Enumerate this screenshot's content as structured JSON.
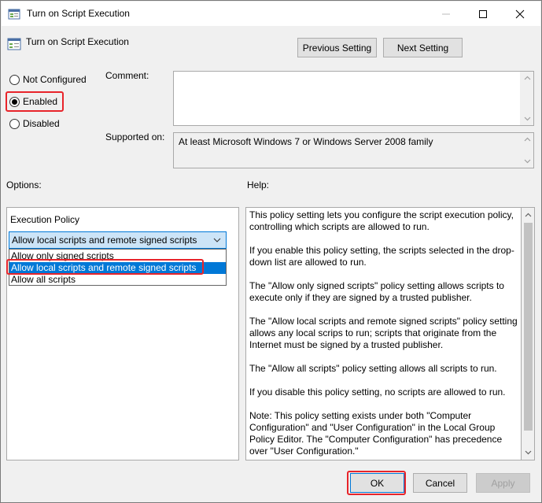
{
  "window": {
    "title": "Turn on Script Execution",
    "icons": {
      "app": "policy-icon",
      "minimize": "minimize-icon",
      "maximize": "maximize-icon",
      "close": "close-icon"
    }
  },
  "header": {
    "title": "Turn on Script Execution",
    "previous_label": "Previous Setting",
    "next_label": "Next Setting"
  },
  "state": {
    "options": [
      "Not Configured",
      "Enabled",
      "Disabled"
    ],
    "selected": "Enabled"
  },
  "comment": {
    "label": "Comment:",
    "value": ""
  },
  "supported": {
    "label": "Supported on:",
    "value": "At least Microsoft Windows 7 or Windows Server 2008 family"
  },
  "options_panel": {
    "label": "Options:",
    "execution_policy_label": "Execution Policy",
    "selected_value": "Allow local scripts and remote signed scripts",
    "dropdown_options": [
      "Allow only signed scripts",
      "Allow local scripts and remote signed scripts",
      "Allow all scripts"
    ]
  },
  "help": {
    "label": "Help:",
    "paragraphs": [
      "This policy setting lets you configure the script execution policy, controlling which scripts are allowed to run.",
      "If you enable this policy setting, the scripts selected in the drop-down list are allowed to run.",
      "The \"Allow only signed scripts\" policy setting allows scripts to execute only if they are signed by a trusted publisher.",
      "The \"Allow local scripts and remote signed scripts\" policy setting allows any local scrips to run; scripts that originate from the Internet must be signed by a trusted publisher.",
      "The \"Allow all scripts\" policy setting allows all scripts to run.",
      "If you disable this policy setting, no scripts are allowed to run.",
      "Note: This policy setting exists under both \"Computer Configuration\" and \"User Configuration\" in the Local Group Policy Editor. The \"Computer Configuration\" has precedence over \"User Configuration.\""
    ]
  },
  "footer": {
    "ok_label": "OK",
    "cancel_label": "Cancel",
    "apply_label": "Apply"
  },
  "colors": {
    "highlight": "#e8242a",
    "accent": "#0078d7"
  }
}
